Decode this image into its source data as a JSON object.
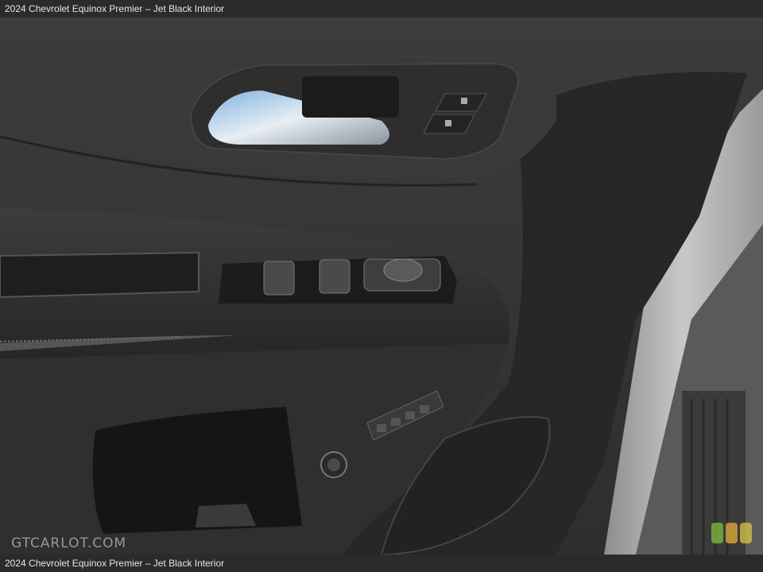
{
  "caption": {
    "title": "2024 Chevrolet Equinox Premier – Jet Black Interior"
  },
  "watermark": {
    "text": "GTCARLOT.COM"
  },
  "colors": {
    "panel_dark": "#2a2a2a",
    "panel_mid": "#3a3a3a",
    "fabric": "#262626",
    "door_frame": "#b9b9b9",
    "chrome": "#cfd8e0",
    "badge": [
      "#7fbf3f",
      "#e2b23a",
      "#d9c54a"
    ]
  }
}
